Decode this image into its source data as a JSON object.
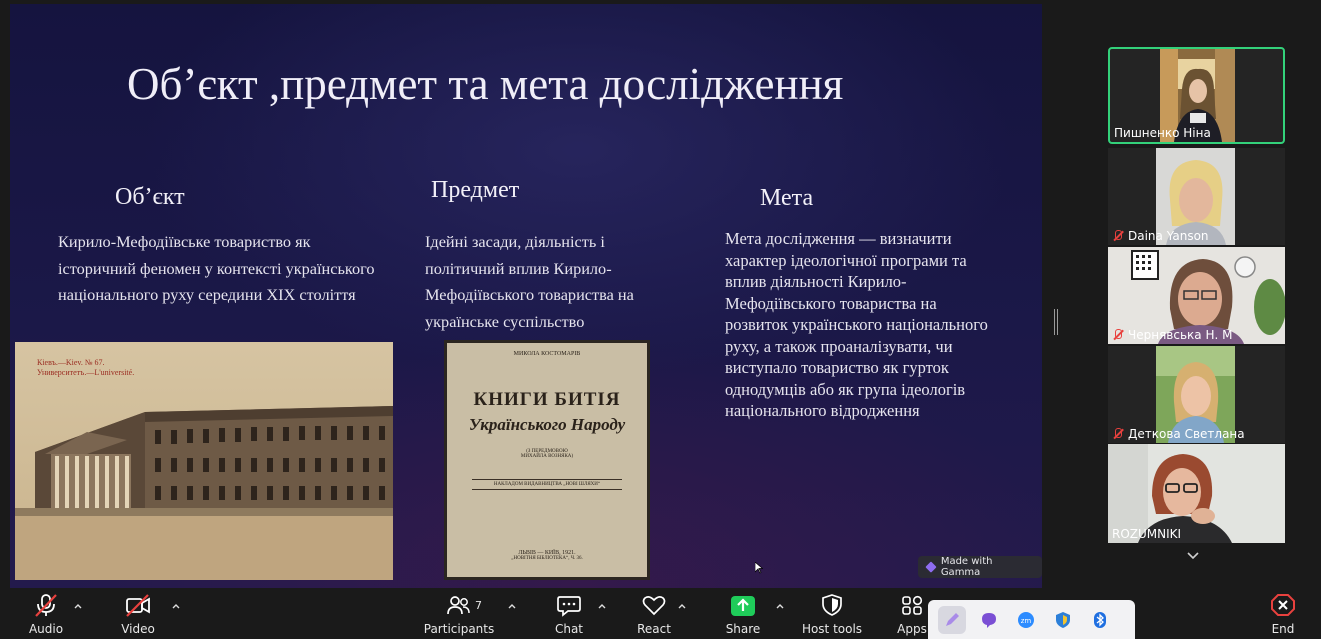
{
  "slide": {
    "title": "Об’єкт ,предмет та мета дослідження",
    "columns": [
      {
        "heading": "Об’єкт",
        "body": [
          "Кирило-Мефодіївське товариство як",
          "історичний феномен у контексті українського",
          "національного руху середини XIX століття"
        ]
      },
      {
        "heading": "Предмет",
        "body": [
          "Ідейні засади, діяльність і",
          "політичний вплив Кирило-",
          "Мефодіївського товариства на",
          "українське суспільство"
        ]
      },
      {
        "heading": "Мета",
        "body": [
          "Мета дослідження — визначити",
          "характер ідеологічної програми та",
          "вплив діяльності Кирило-",
          "Мефодіївського товариства на",
          "розвиток українського національного",
          "руху, а також проаналізувати, чи",
          "виступало товариство як гурток",
          "однодумців або як група ідеологів",
          "національного відродження"
        ]
      }
    ],
    "uni_photo_caption": [
      "Кіевъ.—Kiev. № 67.",
      "Университетъ.—L'université."
    ],
    "book": {
      "author": "МИКОЛА КОСТОМАРІВ",
      "title_line1": "КНИГИ БИТІЯ",
      "title_line2": "Українського Народу",
      "sub1": "(З ПЕРЕДМОВОЮ",
      "sub2": "МИХАЙЛА ВОЗНЯКА)",
      "publisher": "НАКЛАДОМ ВИДАВНИЦТВА „НОВІ ШЛЯХИ“",
      "place": "ЛЬВІВ — КИЇВ, 1921.",
      "series": "„НОВІТНЯ БІБЛІОТЕКА“, Ч. 36."
    },
    "badge": "Made with Gamma"
  },
  "participants_tiles": [
    {
      "name": "Пишненко Ніна",
      "muted": false,
      "active": true
    },
    {
      "name": "Daina Yanson",
      "muted": true,
      "active": false
    },
    {
      "name": "Чернявська Н. М",
      "muted": true,
      "active": false
    },
    {
      "name": "Деткова Светлана",
      "muted": true,
      "active": false
    },
    {
      "name": "ROZUMNIKI",
      "muted": false,
      "active": false
    }
  ],
  "toolbar": {
    "audio": "Audio",
    "video": "Video",
    "participants": "Participants",
    "participants_count": "7",
    "chat": "Chat",
    "react": "React",
    "share": "Share",
    "host_tools": "Host tools",
    "apps": "Apps",
    "end": "End"
  },
  "colors": {
    "accent_green": "#33d17a",
    "share_green": "#1fcc5a",
    "mute_red": "#e8413e",
    "end_red": "#e8413e"
  }
}
